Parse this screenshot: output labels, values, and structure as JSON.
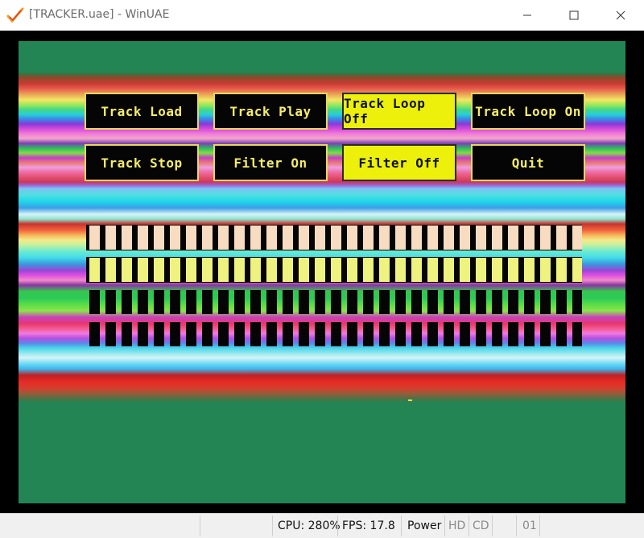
{
  "window": {
    "title": "[TRACKER.uae] - WinUAE",
    "icon": "winuae-check-icon",
    "controls": [
      "minimize-icon",
      "maximize-icon",
      "close-icon"
    ]
  },
  "colors": {
    "screen_bg": "#238553",
    "button_text": "#f4ec6a",
    "button_border": "#e8d85a",
    "button_active_bg": "#ecf00b",
    "vu_row1": "#f7dcc2",
    "vu_row2": "#eef27e",
    "vu_dark": "#050505"
  },
  "buttons": [
    {
      "label": "Track Load",
      "active": false
    },
    {
      "label": "Track Play",
      "active": false
    },
    {
      "label": "Track Loop Off",
      "active": true
    },
    {
      "label": "Track Loop On",
      "active": false
    },
    {
      "label": "Track Stop",
      "active": false
    },
    {
      "label": "Filter On",
      "active": false
    },
    {
      "label": "Filter Off",
      "active": true
    },
    {
      "label": "Quit",
      "active": false
    }
  ],
  "vu_meter": {
    "channels": 4,
    "bars_per_channel": 31,
    "channel_fill": [
      "#f7dcc2",
      "#eef27e",
      "#050505",
      "#050505"
    ]
  },
  "statusbar": {
    "cpu": "CPU: 280%",
    "fps": "FPS: 17.8",
    "power": "Power",
    "hd": "HD",
    "cd": "CD",
    "drive": "01"
  }
}
